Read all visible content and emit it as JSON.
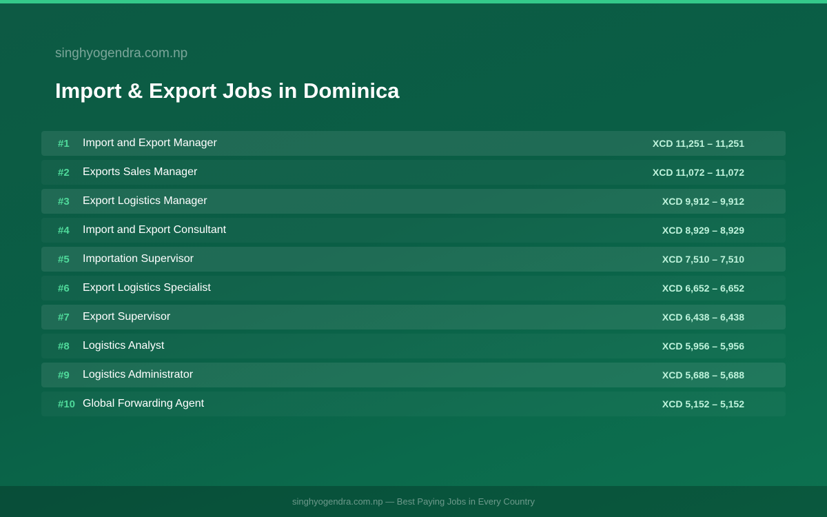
{
  "header": {
    "site": "singhyogendra.com.np",
    "title": "Import & Export Jobs in Dominica"
  },
  "jobs": [
    {
      "rank": "#1",
      "title": "Import and Export Manager",
      "salary": "XCD 11,251 – 11,251"
    },
    {
      "rank": "#2",
      "title": "Exports Sales Manager",
      "salary": "XCD 11,072 – 11,072"
    },
    {
      "rank": "#3",
      "title": "Export Logistics Manager",
      "salary": "XCD 9,912 – 9,912"
    },
    {
      "rank": "#4",
      "title": "Import and Export Consultant",
      "salary": "XCD 8,929 – 8,929"
    },
    {
      "rank": "#5",
      "title": "Importation Supervisor",
      "salary": "XCD 7,510 – 7,510"
    },
    {
      "rank": "#6",
      "title": "Export Logistics Specialist",
      "salary": "XCD 6,652 – 6,652"
    },
    {
      "rank": "#7",
      "title": "Export Supervisor",
      "salary": "XCD 6,438 – 6,438"
    },
    {
      "rank": "#8",
      "title": "Logistics Analyst",
      "salary": "XCD 5,956 – 5,956"
    },
    {
      "rank": "#9",
      "title": "Logistics Administrator",
      "salary": "XCD 5,688 – 5,688"
    },
    {
      "rank": "#10",
      "title": "Global Forwarding Agent",
      "salary": "XCD 5,152 – 5,152"
    }
  ],
  "footer": {
    "text": "singhyogendra.com.np — Best Paying Jobs in Every Country"
  },
  "colors": {
    "accent": "#34c98a",
    "rank": "#4fd99a",
    "salary": "#bff3dc"
  }
}
